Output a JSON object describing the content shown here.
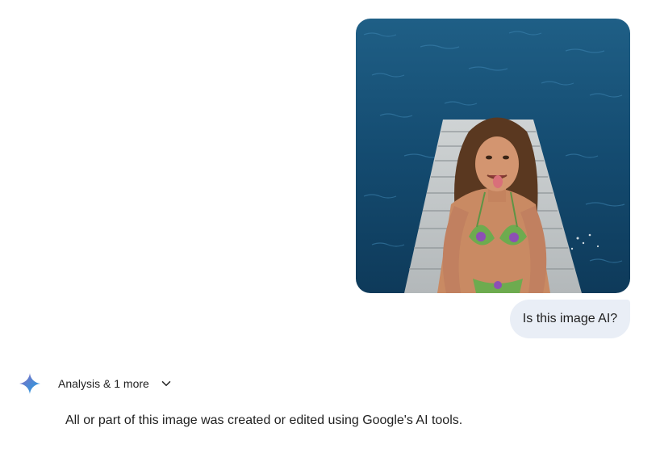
{
  "user_message": {
    "image_alt": "Woman sitting at the end of a wooden dock above deep blue water, tongue out",
    "text": "Is this image AI?"
  },
  "response": {
    "tools_label": "Analysis & 1 more",
    "text": "All or part of this image was created or edited using Google's AI tools."
  },
  "icons": {
    "assistant": "gemini-sparkle-icon",
    "expand": "chevron-down-icon"
  },
  "colors": {
    "user_bubble": "#e9eef6",
    "text": "#1f1f1f",
    "sparkle_blue": "#4285f4"
  }
}
